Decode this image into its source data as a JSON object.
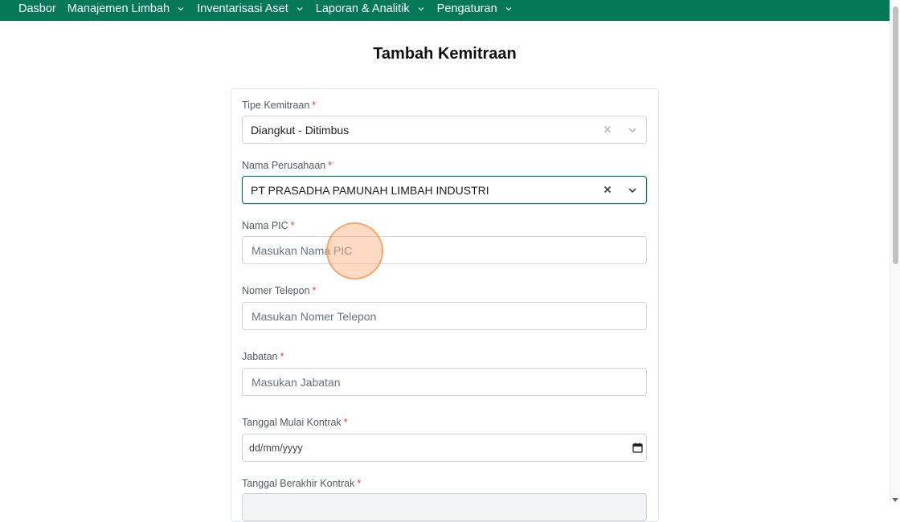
{
  "nav": {
    "items": [
      {
        "label": "Dasbor",
        "has_dropdown": false
      },
      {
        "label": "Manajemen Limbah",
        "has_dropdown": true
      },
      {
        "label": "Inventarisasi Aset",
        "has_dropdown": true
      },
      {
        "label": "Laporan & Analitik",
        "has_dropdown": true
      },
      {
        "label": "Pengaturan",
        "has_dropdown": true
      }
    ]
  },
  "page": {
    "title": "Tambah Kemitraan"
  },
  "form": {
    "required_mark": "*",
    "tipe_kemitraan": {
      "label": "Tipe Kemitraan",
      "value": "Diangkut - Ditimbus"
    },
    "nama_perusahaan": {
      "label": "Nama Perusahaan",
      "value": "PT PRASADHA PAMUNAH LIMBAH INDUSTRI"
    },
    "nama_pic": {
      "label": "Nama PIC",
      "placeholder": "Masukan Nama PIC"
    },
    "nomer_telepon": {
      "label": "Nomer Telepon",
      "placeholder": "Masukan Nomer Telepon"
    },
    "jabatan": {
      "label": "Jabatan",
      "placeholder": "Masukan Jabatan"
    },
    "tanggal_mulai": {
      "label": "Tanggal Mulai Kontrak",
      "placeholder": "dd/mm/yyyy"
    },
    "tanggal_berakhir": {
      "label": "Tanggal Berakhir Kontrak"
    }
  },
  "colors": {
    "navbar": "#047857",
    "required": "#e53e3e",
    "focus_border": "#047857",
    "cursor_highlight": "#fbb078"
  }
}
